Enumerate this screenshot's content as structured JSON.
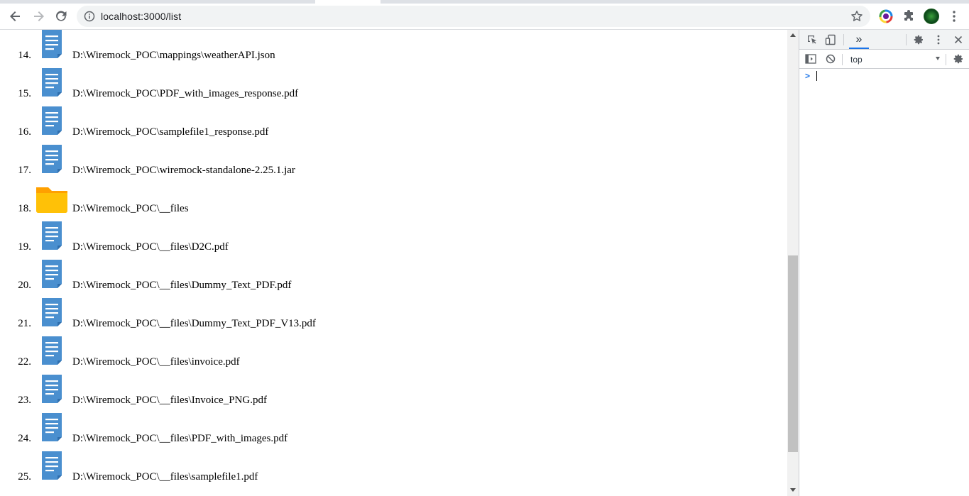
{
  "browser": {
    "url": "localhost:3000/list",
    "buttons": {
      "back": "back",
      "forward": "forward",
      "reload": "reload"
    },
    "icons": [
      "back-arrow-icon",
      "forward-arrow-icon",
      "reload-icon",
      "info-icon",
      "star-icon",
      "color-extension-icon",
      "puzzle-icon",
      "avatar",
      "kebab-menu-icon"
    ]
  },
  "file_list": {
    "items": [
      {
        "index": "14.",
        "type": "file",
        "path": "D:\\Wiremock_POC\\mappings\\weatherAPI.json"
      },
      {
        "index": "15.",
        "type": "file",
        "path": "D:\\Wiremock_POC\\PDF_with_images_response.pdf"
      },
      {
        "index": "16.",
        "type": "file",
        "path": "D:\\Wiremock_POC\\samplefile1_response.pdf"
      },
      {
        "index": "17.",
        "type": "file",
        "path": "D:\\Wiremock_POC\\wiremock-standalone-2.25.1.jar"
      },
      {
        "index": "18.",
        "type": "folder",
        "path": "D:\\Wiremock_POC\\__files"
      },
      {
        "index": "19.",
        "type": "file",
        "path": "D:\\Wiremock_POC\\__files\\D2C.pdf"
      },
      {
        "index": "20.",
        "type": "file",
        "path": "D:\\Wiremock_POC\\__files\\Dummy_Text_PDF.pdf"
      },
      {
        "index": "21.",
        "type": "file",
        "path": "D:\\Wiremock_POC\\__files\\Dummy_Text_PDF_V13.pdf"
      },
      {
        "index": "22.",
        "type": "file",
        "path": "D:\\Wiremock_POC\\__files\\invoice.pdf"
      },
      {
        "index": "23.",
        "type": "file",
        "path": "D:\\Wiremock_POC\\__files\\Invoice_PNG.pdf"
      },
      {
        "index": "24.",
        "type": "file",
        "path": "D:\\Wiremock_POC\\__files\\PDF_with_images.pdf"
      },
      {
        "index": "25.",
        "type": "file",
        "path": "D:\\Wiremock_POC\\__files\\samplefile1.pdf"
      }
    ]
  },
  "devtools": {
    "context": "top",
    "prompt": ">",
    "more_tabs": "»"
  },
  "colors": {
    "file_icon": "#4a8fcf",
    "file_icon_fold": "#2f6fae",
    "folder_icon": "#ffc107",
    "folder_icon_back": "#ffa000",
    "devtools_accent": "#1a73e8"
  }
}
